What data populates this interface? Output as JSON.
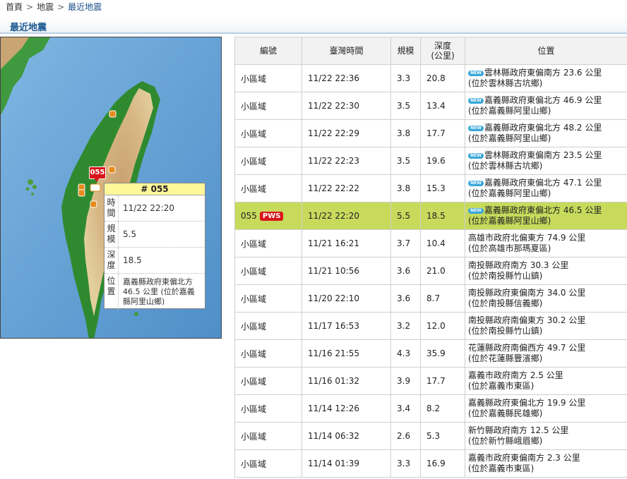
{
  "breadcrumb": [
    "首頁",
    "地震",
    "最近地震"
  ],
  "breadcrumb_sep": ">",
  "section_title": "最近地震",
  "map": {
    "marker_label": "055",
    "popup": {
      "title": "# 055",
      "rows": [
        {
          "label": "時間",
          "value": "11/22 22:20"
        },
        {
          "label": "規模",
          "value": "5.5"
        },
        {
          "label": "深度",
          "value": "18.5"
        },
        {
          "label": "位置",
          "value": "嘉義縣政府東偏北方 46.5 公里 (位於嘉義縣阿里山鄉)"
        }
      ]
    }
  },
  "table": {
    "headers": [
      "編號",
      "臺灣時間",
      "規模",
      "深度\n(公里)",
      "位置"
    ],
    "new_label": "NEW",
    "pws_label": "PWS",
    "rows": [
      {
        "id": "小區域",
        "time": "11/22 22:36",
        "mag": "3.3",
        "depth": "20.8",
        "loc1": "雲林縣政府東偏南方 23.6 公里",
        "loc2": "(位於雲林縣古坑鄉)",
        "is_new": true,
        "pws": false,
        "highlight": false
      },
      {
        "id": "小區域",
        "time": "11/22 22:30",
        "mag": "3.5",
        "depth": "13.4",
        "loc1": "嘉義縣政府東偏北方 46.9 公里",
        "loc2": "(位於嘉義縣阿里山鄉)",
        "is_new": true,
        "pws": false,
        "highlight": false
      },
      {
        "id": "小區域",
        "time": "11/22 22:29",
        "mag": "3.8",
        "depth": "17.7",
        "loc1": "嘉義縣政府東偏北方 48.2 公里",
        "loc2": "(位於嘉義縣阿里山鄉)",
        "is_new": true,
        "pws": false,
        "highlight": false
      },
      {
        "id": "小區域",
        "time": "11/22 22:23",
        "mag": "3.5",
        "depth": "19.6",
        "loc1": "雲林縣政府東偏南方 23.5 公里",
        "loc2": "(位於雲林縣古坑鄉)",
        "is_new": true,
        "pws": false,
        "highlight": false
      },
      {
        "id": "小區域",
        "time": "11/22 22:22",
        "mag": "3.8",
        "depth": "15.3",
        "loc1": "嘉義縣政府東偏北方 47.1 公里",
        "loc2": "(位於嘉義縣阿里山鄉)",
        "is_new": true,
        "pws": false,
        "highlight": false
      },
      {
        "id": "055",
        "time": "11/22 22:20",
        "mag": "5.5",
        "depth": "18.5",
        "loc1": "嘉義縣政府東偏北方 46.5 公里",
        "loc2": "(位於嘉義縣阿里山鄉)",
        "is_new": true,
        "pws": true,
        "highlight": true
      },
      {
        "id": "小區域",
        "time": "11/21 16:21",
        "mag": "3.7",
        "depth": "10.4",
        "loc1": "高雄市政府北偏東方 74.9 公里",
        "loc2": "(位於高雄市那瑪夏區)",
        "is_new": false,
        "pws": false,
        "highlight": false
      },
      {
        "id": "小區域",
        "time": "11/21 10:56",
        "mag": "3.6",
        "depth": "21.0",
        "loc1": "南投縣政府南方 30.3 公里",
        "loc2": "(位於南投縣竹山鎮)",
        "is_new": false,
        "pws": false,
        "highlight": false
      },
      {
        "id": "小區域",
        "time": "11/20 22:10",
        "mag": "3.6",
        "depth": "8.7",
        "loc1": "南投縣政府東偏南方 34.0 公里",
        "loc2": "(位於南投縣信義鄉)",
        "is_new": false,
        "pws": false,
        "highlight": false
      },
      {
        "id": "小區域",
        "time": "11/17 16:53",
        "mag": "3.2",
        "depth": "12.0",
        "loc1": "南投縣政府南偏東方 30.2 公里",
        "loc2": "(位於南投縣竹山鎮)",
        "is_new": false,
        "pws": false,
        "highlight": false
      },
      {
        "id": "小區域",
        "time": "11/16 21:55",
        "mag": "4.3",
        "depth": "35.9",
        "loc1": "花蓮縣政府南偏西方 49.7 公里",
        "loc2": "(位於花蓮縣豐濱鄉)",
        "is_new": false,
        "pws": false,
        "highlight": false
      },
      {
        "id": "小區域",
        "time": "11/16 01:32",
        "mag": "3.9",
        "depth": "17.7",
        "loc1": "嘉義市政府南方 2.5 公里",
        "loc2": "(位於嘉義市東區)",
        "is_new": false,
        "pws": false,
        "highlight": false
      },
      {
        "id": "小區域",
        "time": "11/14 12:26",
        "mag": "3.4",
        "depth": "8.2",
        "loc1": "嘉義縣政府東偏北方 19.9 公里",
        "loc2": "(位於嘉義縣民雄鄉)",
        "is_new": false,
        "pws": false,
        "highlight": false
      },
      {
        "id": "小區域",
        "time": "11/14 06:32",
        "mag": "2.6",
        "depth": "5.3",
        "loc1": "新竹縣政府南方 12.5 公里",
        "loc2": "(位於新竹縣峨眉鄉)",
        "is_new": false,
        "pws": false,
        "highlight": false
      },
      {
        "id": "小區域",
        "time": "11/14 01:39",
        "mag": "3.3",
        "depth": "16.9",
        "loc1": "嘉義市政府東偏南方 2.3 公里",
        "loc2": "(位於嘉義市東區)",
        "is_new": false,
        "pws": false,
        "highlight": false
      }
    ]
  },
  "colors": {
    "highlight_row": "#c7da5c",
    "pws_badge": "#d9151b",
    "new_badge": "#39a7d8",
    "popup_header": "#fff79a",
    "section_title": "#1d5a94",
    "marker": "#d9151b"
  }
}
